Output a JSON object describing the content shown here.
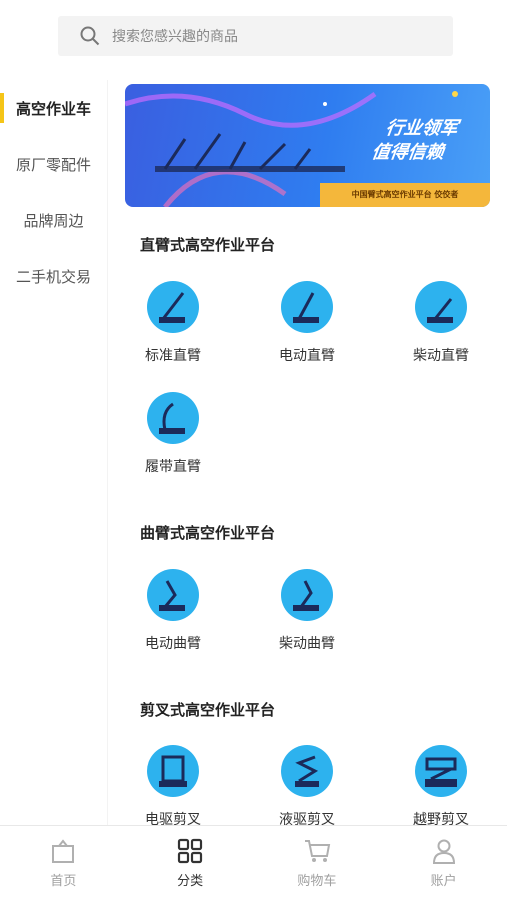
{
  "search": {
    "placeholder": "搜索您感兴趣的商品"
  },
  "sidebar": {
    "items": [
      {
        "label": "高空作业车",
        "active": true
      },
      {
        "label": "原厂零配件",
        "active": false
      },
      {
        "label": "品牌周边",
        "active": false
      },
      {
        "label": "二手机交易",
        "active": false
      }
    ]
  },
  "banner": {
    "line1": "行业领军",
    "line2": "值得信赖",
    "strip": "中国臂式高空作业平台 佼佼者"
  },
  "sections": [
    {
      "title": "直臂式高空作业平台",
      "items": [
        "标准直臂",
        "电动直臂",
        "柴动直臂",
        "履带直臂"
      ]
    },
    {
      "title": "曲臂式高空作业平台",
      "items": [
        "电动曲臂",
        "柴动曲臂"
      ]
    },
    {
      "title": "剪叉式高空作业平台",
      "items": [
        "电驱剪叉",
        "液驱剪叉",
        "越野剪叉"
      ]
    }
  ],
  "tabbar": {
    "items": [
      {
        "label": "首页",
        "icon": "home-icon",
        "active": false
      },
      {
        "label": "分类",
        "icon": "category-icon",
        "active": true
      },
      {
        "label": "购物车",
        "icon": "cart-icon",
        "active": false
      },
      {
        "label": "账户",
        "icon": "user-icon",
        "active": false
      }
    ]
  },
  "colors": {
    "accent": "#f5c518",
    "icon_bg": "#2db2ee",
    "banner": "#2f7df0"
  }
}
